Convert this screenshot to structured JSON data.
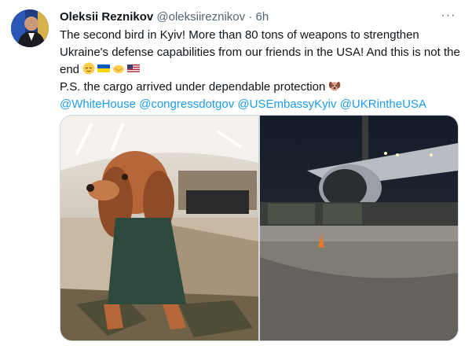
{
  "author": {
    "name": "Oleksii Reznikov",
    "handle": "@oleksiireznikov",
    "separator": "·",
    "time": "6h",
    "avatar_icon": "avatar-portrait-icon"
  },
  "more_label": "···",
  "tweet": {
    "line1": "The second bird in Kyiv! More than 80 tons of weapons to strengthen Ukraine's defense capabilities from our friends in the USA! And this is not the end",
    "emojis_line1": [
      "relieved-face-emoji",
      "ukraine-flag-emoji",
      "handshake-emoji",
      "usa-flag-emoji"
    ],
    "line2": "P.S. the cargo arrived under dependable protection",
    "emoji_line2": "dog-face-emoji",
    "mentions": [
      "@WhiteHouse",
      "@congressdotgov",
      "@USEmbassyKyiv",
      "@UKRintheUSA"
    ]
  },
  "colors": {
    "link": "#1d9bf0",
    "text": "#0f1419",
    "secondary": "#536471",
    "border": "#cfd9de"
  }
}
